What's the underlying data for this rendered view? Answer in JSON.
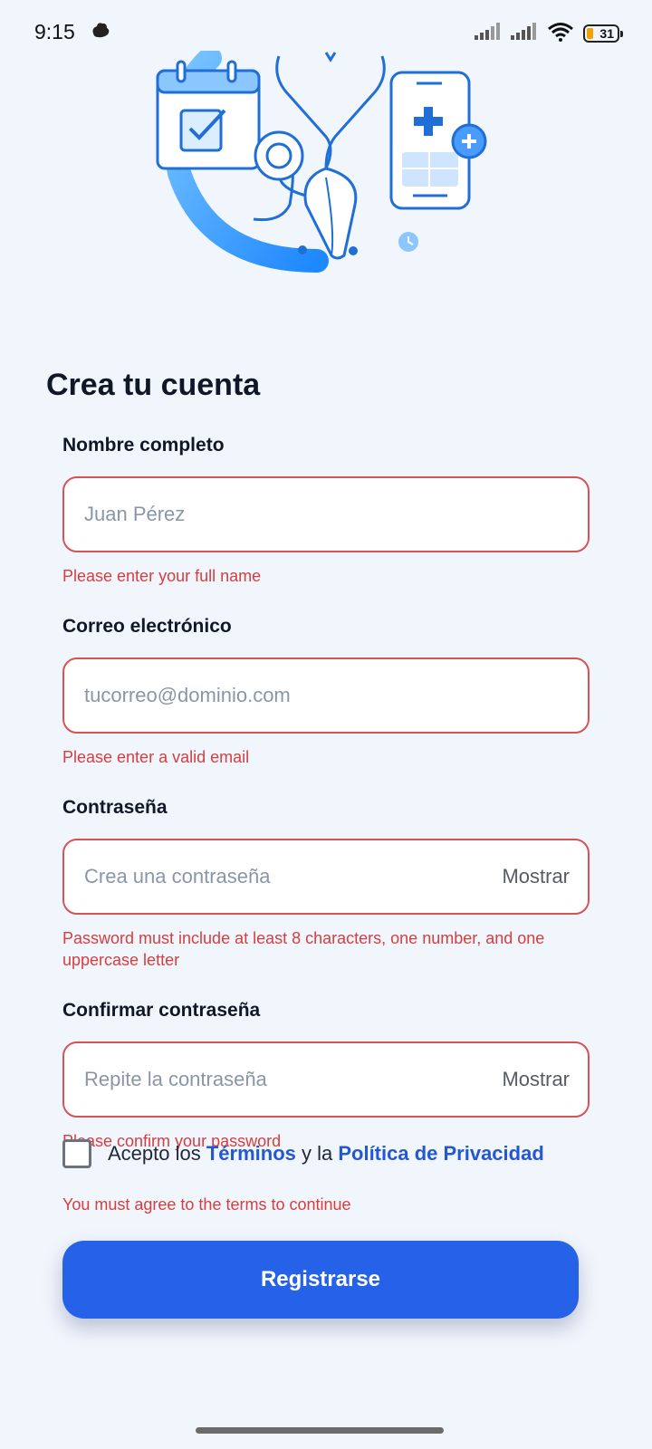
{
  "status_bar": {
    "time": "9:15",
    "battery_level": "31",
    "icons": [
      "app-notification-icon",
      "signal-icon",
      "signal-icon",
      "wifi-icon",
      "battery-icon"
    ]
  },
  "hero": {
    "icons": [
      "calendar-check-icon",
      "stethoscope-icon",
      "medical-phone-icon",
      "clock-icon"
    ]
  },
  "page": {
    "title": "Crea tu cuenta"
  },
  "form": {
    "full_name": {
      "label": "Nombre completo",
      "placeholder": "Juan Pérez",
      "value": "",
      "error": "Please enter your full name"
    },
    "email": {
      "label": "Correo electrónico",
      "placeholder": "tucorreo@dominio.com",
      "value": "",
      "error": "Please enter a valid email"
    },
    "password": {
      "label": "Contraseña",
      "placeholder": "Crea una contraseña",
      "value": "",
      "toggle": "Mostrar",
      "error": "Password must include at least 8 characters, one number, and one uppercase letter"
    },
    "confirm_password": {
      "label": "Confirmar contraseña",
      "placeholder": "Repite la contraseña",
      "value": "",
      "toggle": "Mostrar",
      "error": "Please confirm your password"
    },
    "terms": {
      "checked": false,
      "prefix": "Acepto los ",
      "terms_link": "Términos",
      "middle": " y la ",
      "privacy_link": "Política de Privacidad",
      "error": "You must agree to the terms to continue"
    },
    "submit_label": "Registrarse"
  },
  "colors": {
    "primary": "#2562e8",
    "error": "#d43f3f",
    "background": "#f1f5fc",
    "link": "#2457d6"
  }
}
